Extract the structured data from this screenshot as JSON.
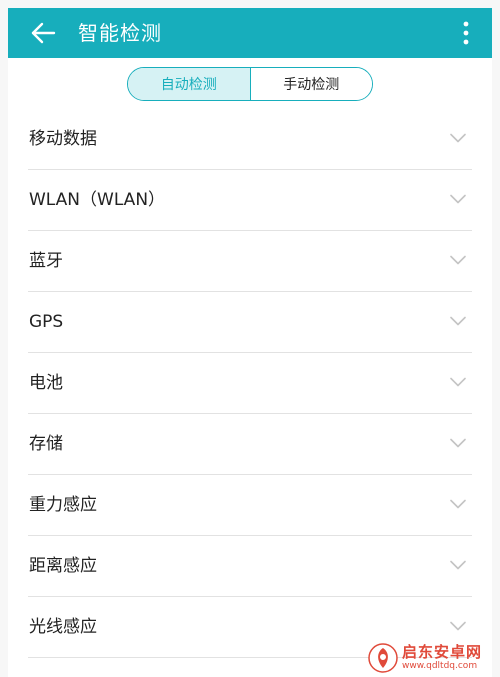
{
  "app_bar": {
    "title": "智能检测",
    "back_icon": "arrow-left-icon",
    "more_icon": "more-vertical-icon",
    "color": "#17aebc"
  },
  "tabs": [
    {
      "label": "自动检测",
      "selected": true
    },
    {
      "label": "手动检测",
      "selected": false
    }
  ],
  "items": [
    {
      "label": "移动数据"
    },
    {
      "label": "WLAN（WLAN）"
    },
    {
      "label": "蓝牙"
    },
    {
      "label": "GPS"
    },
    {
      "label": "电池"
    },
    {
      "label": "存储"
    },
    {
      "label": "重力感应"
    },
    {
      "label": "距离感应"
    },
    {
      "label": "光线感应"
    }
  ],
  "watermark": {
    "name": "启东安卓网",
    "url": "www.qdltdq.com"
  }
}
